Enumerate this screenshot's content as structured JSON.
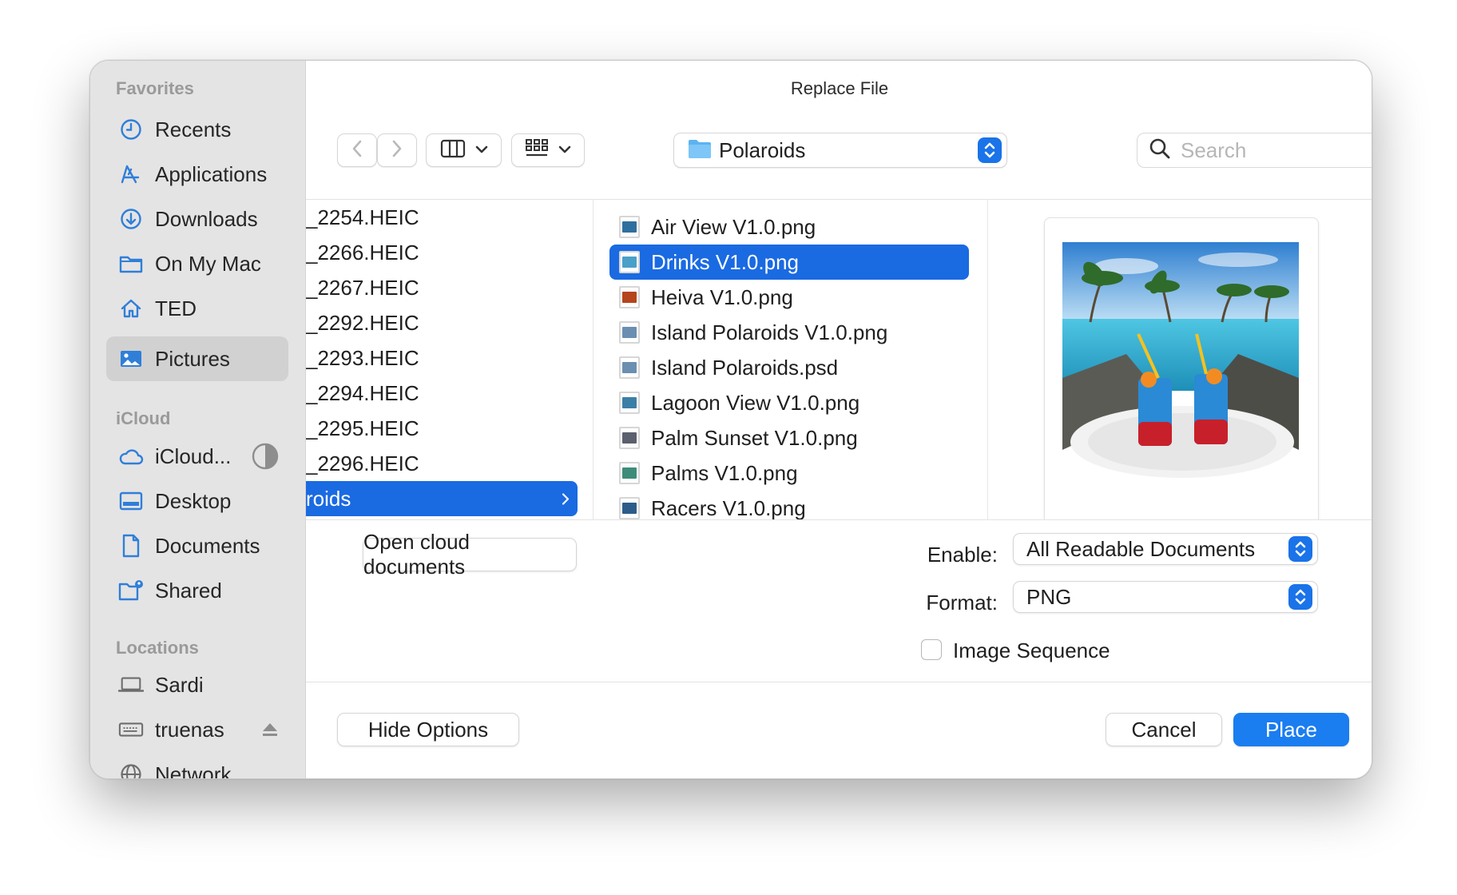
{
  "dialog": {
    "title": "Replace File"
  },
  "sidebar": {
    "sections": [
      {
        "title": "Favorites"
      },
      {
        "title": "iCloud"
      },
      {
        "title": "Locations"
      }
    ],
    "favorites": [
      {
        "label": "Recents",
        "icon": "clock-icon"
      },
      {
        "label": "Applications",
        "icon": "applications-icon"
      },
      {
        "label": "Downloads",
        "icon": "download-icon"
      },
      {
        "label": "On My Mac",
        "icon": "folder-icon"
      },
      {
        "label": "TED",
        "icon": "home-icon"
      },
      {
        "label": "Pictures",
        "icon": "photos-icon",
        "selected": true
      }
    ],
    "icloud": [
      {
        "label": "iCloud...",
        "icon": "cloud-icon"
      },
      {
        "label": "Desktop",
        "icon": "desktop-icon"
      },
      {
        "label": "Documents",
        "icon": "document-icon"
      },
      {
        "label": "Shared",
        "icon": "shared-folder-icon"
      }
    ],
    "locations": [
      {
        "label": "Sardi",
        "icon": "laptop-icon"
      },
      {
        "label": "truenas",
        "icon": "drive-icon"
      },
      {
        "label": "Network",
        "icon": "globe-icon"
      }
    ]
  },
  "toolbar": {
    "location": "Polaroids",
    "search_placeholder": "Search"
  },
  "browser": {
    "column1": [
      "_2254.HEIC",
      "_2266.HEIC",
      "_2267.HEIC",
      "_2292.HEIC",
      "_2293.HEIC",
      "_2294.HEIC",
      "_2295.HEIC",
      "_2296.HEIC",
      "roids"
    ],
    "files": [
      {
        "name": "Air View V1.0.png",
        "thumb": "#2f6f9e"
      },
      {
        "name": "Drinks V1.0.png",
        "thumb": "#4aa0c8",
        "selected": true
      },
      {
        "name": "Heiva V1.0.png",
        "thumb": "#b5451b"
      },
      {
        "name": "Island Polaroids V1.0.png",
        "thumb": "#6b8fb0"
      },
      {
        "name": "Island Polaroids.psd",
        "thumb": "#6b8fb0"
      },
      {
        "name": "Lagoon View V1.0.png",
        "thumb": "#3b7fa6"
      },
      {
        "name": "Palm Sunset V1.0.png",
        "thumb": "#5b5f6e"
      },
      {
        "name": "Palms V1.0.png",
        "thumb": "#3d8c7a"
      },
      {
        "name": "Racers V1.0.png",
        "thumb": "#2d5c8a"
      }
    ]
  },
  "options": {
    "open_cloud_label": "Open cloud documents",
    "enable_label": "Enable:",
    "enable_value": "All Readable Documents",
    "format_label": "Format:",
    "format_value": "PNG",
    "image_sequence_label": "Image Sequence"
  },
  "footer": {
    "hide_options_label": "Hide Options",
    "cancel_label": "Cancel",
    "place_label": "Place"
  },
  "colors": {
    "accent": "#1a6ae2",
    "primary_button": "#1a7df0",
    "sidebar_bg": "#e5e4e4",
    "sidebar_icon": "#2f7fd9"
  }
}
